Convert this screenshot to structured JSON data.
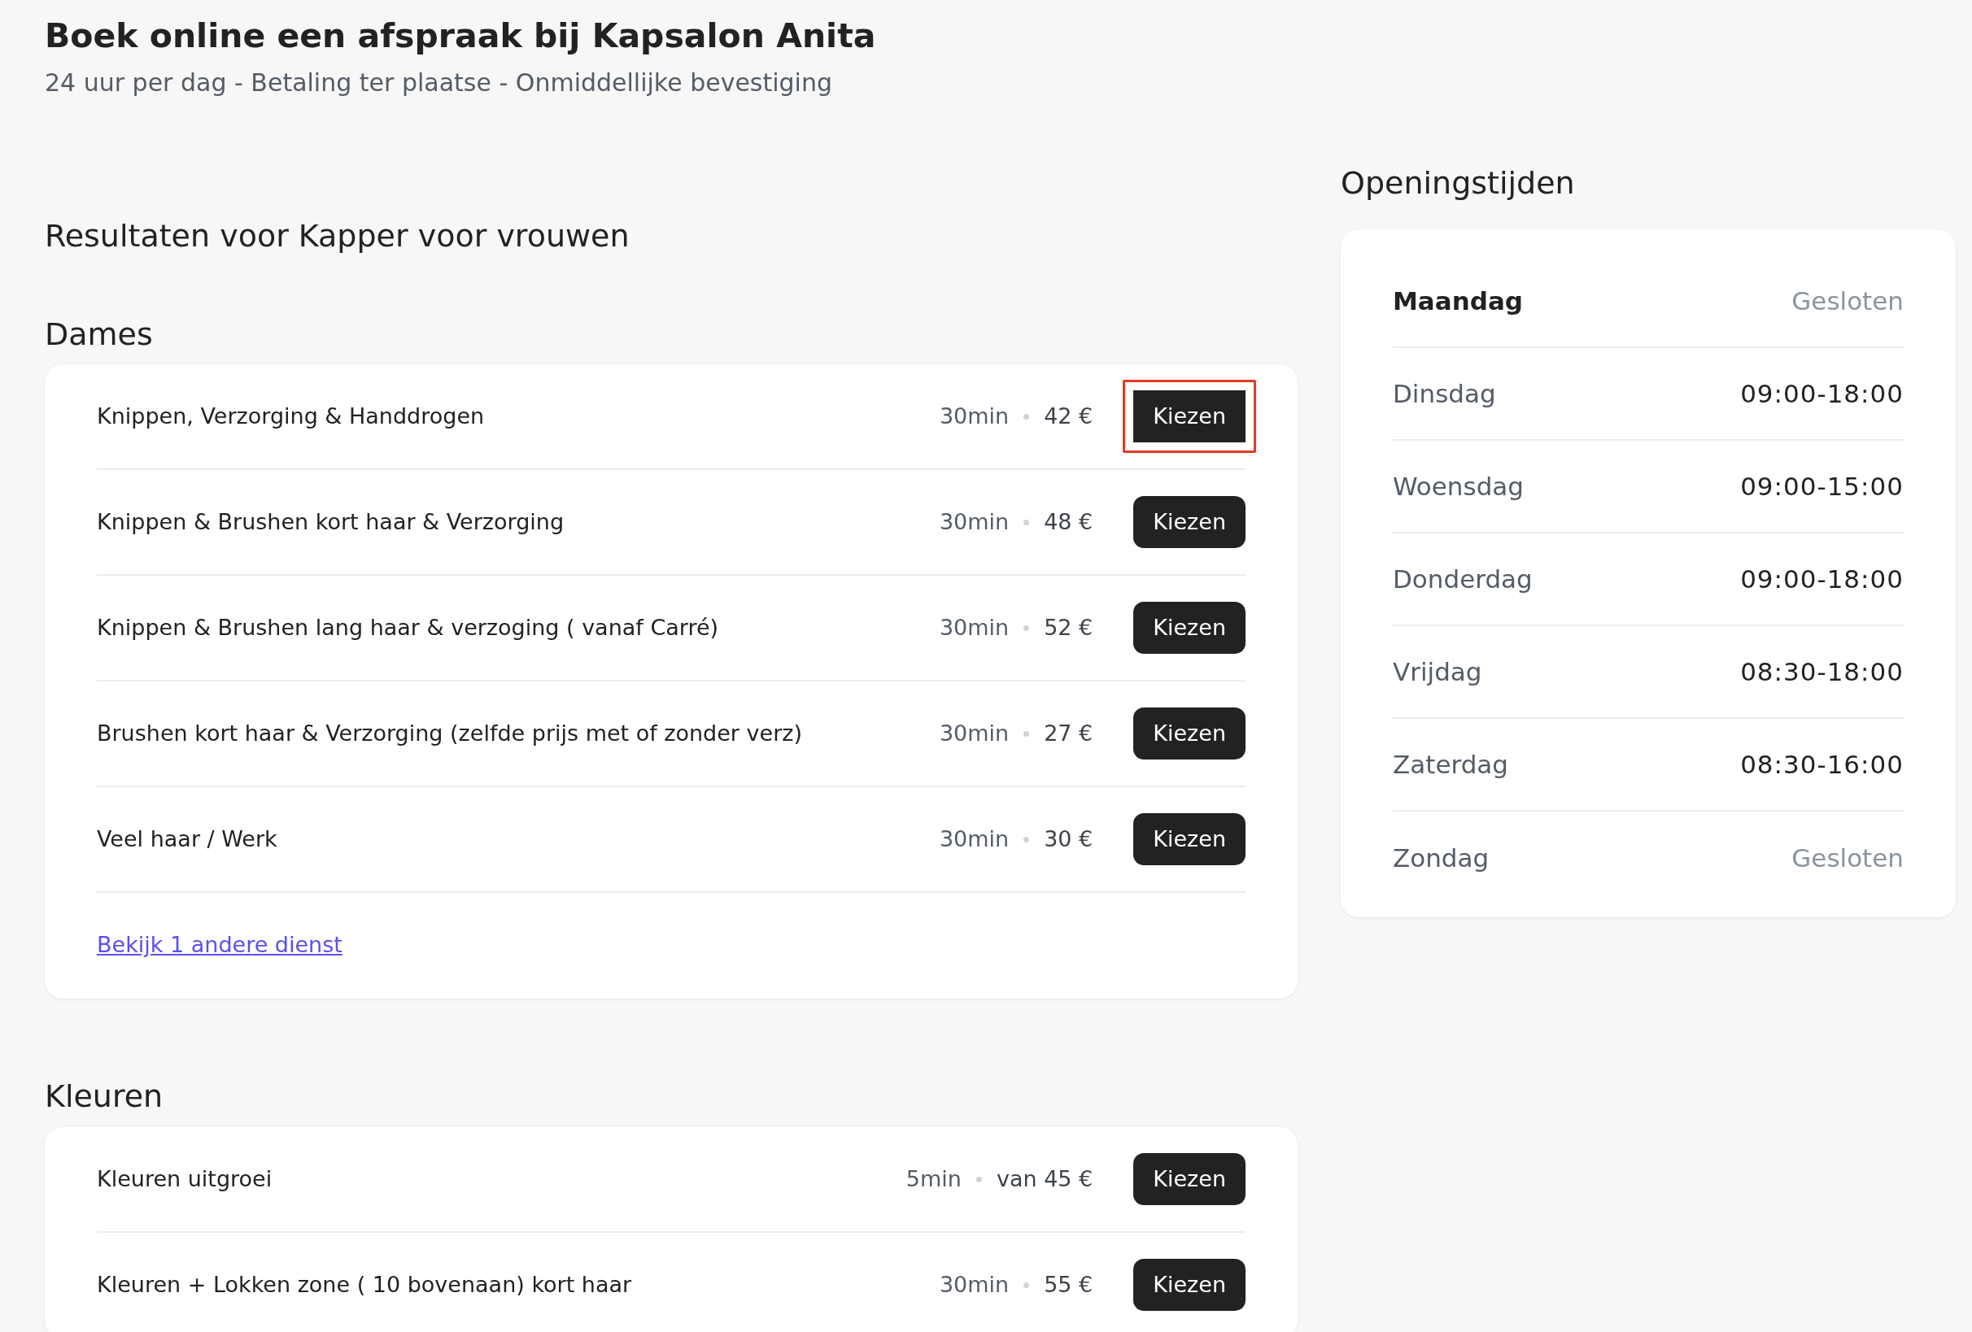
{
  "header": {
    "title": "Boek online een afspraak bij Kapsalon Anita",
    "subtitle": "24 uur per dag - Betaling ter plaatse - Onmiddellijke bevestiging"
  },
  "results_heading": "Resultaten voor Kapper voor vrouwen",
  "categories": [
    {
      "name": "Dames",
      "services": [
        {
          "name": "Knippen, Verzorging & Handdrogen",
          "duration": "30min",
          "price": "42 €",
          "button": "Kiezen",
          "highlighted": true
        },
        {
          "name": "Knippen & Brushen kort haar & Verzorging",
          "duration": "30min",
          "price": "48 €",
          "button": "Kiezen",
          "highlighted": false
        },
        {
          "name": "Knippen & Brushen lang haar & verzoging ( vanaf Carré)",
          "duration": "30min",
          "price": "52 €",
          "button": "Kiezen",
          "highlighted": false
        },
        {
          "name": "Brushen kort haar & Verzorging (zelfde prijs met of zonder verz)",
          "duration": "30min",
          "price": "27 €",
          "button": "Kiezen",
          "highlighted": false
        },
        {
          "name": "Veel haar / Werk",
          "duration": "30min",
          "price": "30 €",
          "button": "Kiezen",
          "highlighted": false
        }
      ],
      "more_link": "Bekijk 1 andere dienst"
    },
    {
      "name": "Kleuren",
      "services": [
        {
          "name": "Kleuren uitgroei",
          "duration": "5min",
          "price": "van 45 €",
          "button": "Kiezen",
          "highlighted": false
        },
        {
          "name": "Kleuren + Lokken zone ( 10 bovenaan) kort haar",
          "duration": "30min",
          "price": "55 €",
          "button": "Kiezen",
          "highlighted": false
        }
      ]
    }
  ],
  "opening_hours": {
    "title": "Openingstijden",
    "days": [
      {
        "day": "Maandag",
        "hours": "Gesloten",
        "today": true,
        "closed": true
      },
      {
        "day": "Dinsdag",
        "hours": "09:00-18:00",
        "today": false,
        "closed": false
      },
      {
        "day": "Woensdag",
        "hours": "09:00-15:00",
        "today": false,
        "closed": false
      },
      {
        "day": "Donderdag",
        "hours": "09:00-18:00",
        "today": false,
        "closed": false
      },
      {
        "day": "Vrijdag",
        "hours": "08:30-18:00",
        "today": false,
        "closed": false
      },
      {
        "day": "Zaterdag",
        "hours": "08:30-16:00",
        "today": false,
        "closed": false
      },
      {
        "day": "Zondag",
        "hours": "Gesloten",
        "today": false,
        "closed": true
      }
    ]
  }
}
